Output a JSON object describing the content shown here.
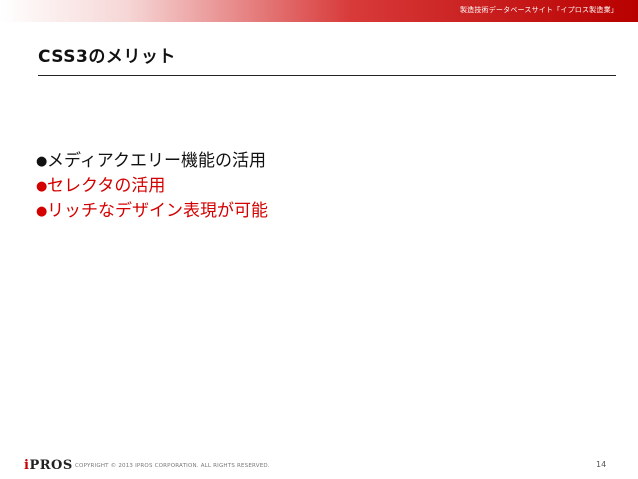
{
  "header": {
    "site_name": "製造技術データベースサイト「イプロス製造業」"
  },
  "slide": {
    "title": "CSS3のメリット",
    "bullets": [
      {
        "marker": "●",
        "text": "メディアクエリー機能の活用",
        "color": "#111111"
      },
      {
        "marker": "●",
        "text": "セレクタの活用",
        "color": "#d40000"
      },
      {
        "marker": "●",
        "text": "リッチなデザイン表現が可能",
        "color": "#d40000"
      }
    ]
  },
  "footer": {
    "logo_mark": "i",
    "logo_text": "PROS",
    "copyright": "COPYRIGHT © 2013 IPROS CORPORATION. ALL RIGHTS RESERVED.",
    "page_number": "14"
  },
  "colors": {
    "accent": "#c80000",
    "bar_dark": "#b80000"
  }
}
